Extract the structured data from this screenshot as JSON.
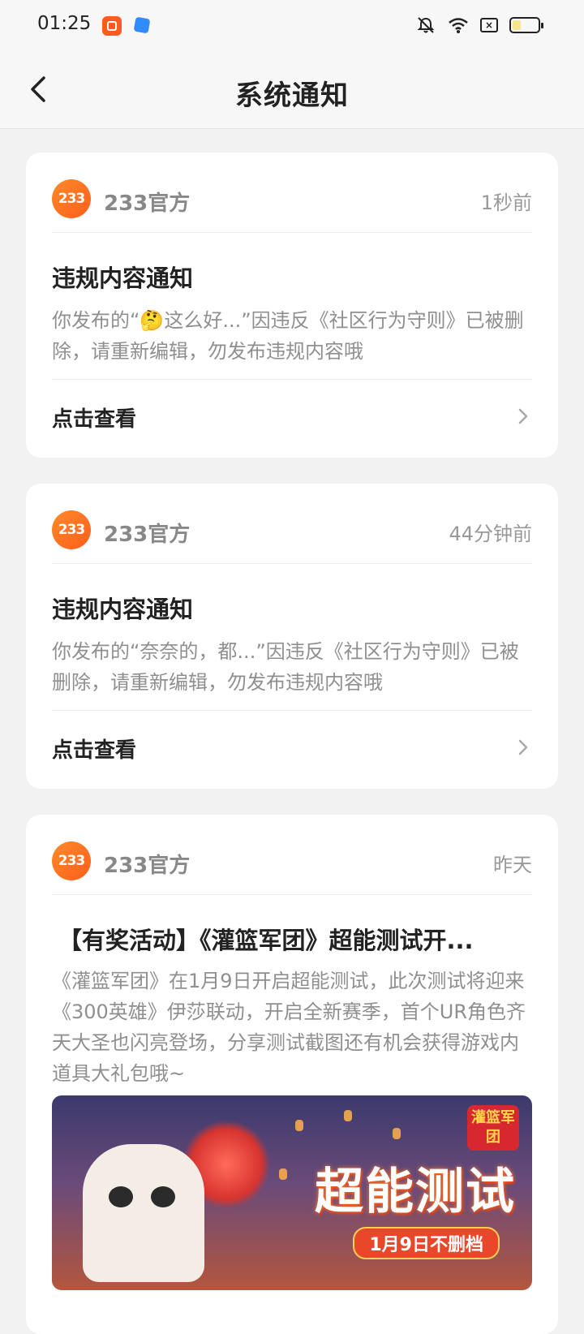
{
  "status_bar": {
    "time": "01:25"
  },
  "header": {
    "title": "系统通知"
  },
  "notifications": [
    {
      "avatar_text": "233",
      "sender": "233官方",
      "time": "1秒前",
      "title": "违规内容通知",
      "body": "你发布的“🤔这么好...”因违反《社区行为守则》已被删除，请重新编辑，勿发布违规内容哦",
      "action": "点击查看"
    },
    {
      "avatar_text": "233",
      "sender": "233官方",
      "time": "44分钟前",
      "title": "违规内容通知",
      "body": "你发布的“奈奈的，都...”因违反《社区行为守则》已被删除，请重新编辑，勿发布违规内容哦",
      "action": "点击查看"
    },
    {
      "avatar_text": "233",
      "sender": "233官方",
      "time": "昨天",
      "title": "【有奖活动】《灌篮军团》超能测试开...",
      "body": "《灌篮军团》在1月9日开启超能测试，此次测试将迎来《300英雄》伊莎联动，开启全新赛季，首个UR角色齐天大圣也闪亮登场，分享测试截图还有机会获得游戏内道具大礼包哦~",
      "banner": {
        "headline": "超能测试",
        "subline": "1月9日不删档",
        "logo": "灌篮军团"
      }
    }
  ],
  "colors": {
    "accent": "#ff6a1f",
    "background": "#f2f2f2",
    "card": "#ffffff"
  }
}
